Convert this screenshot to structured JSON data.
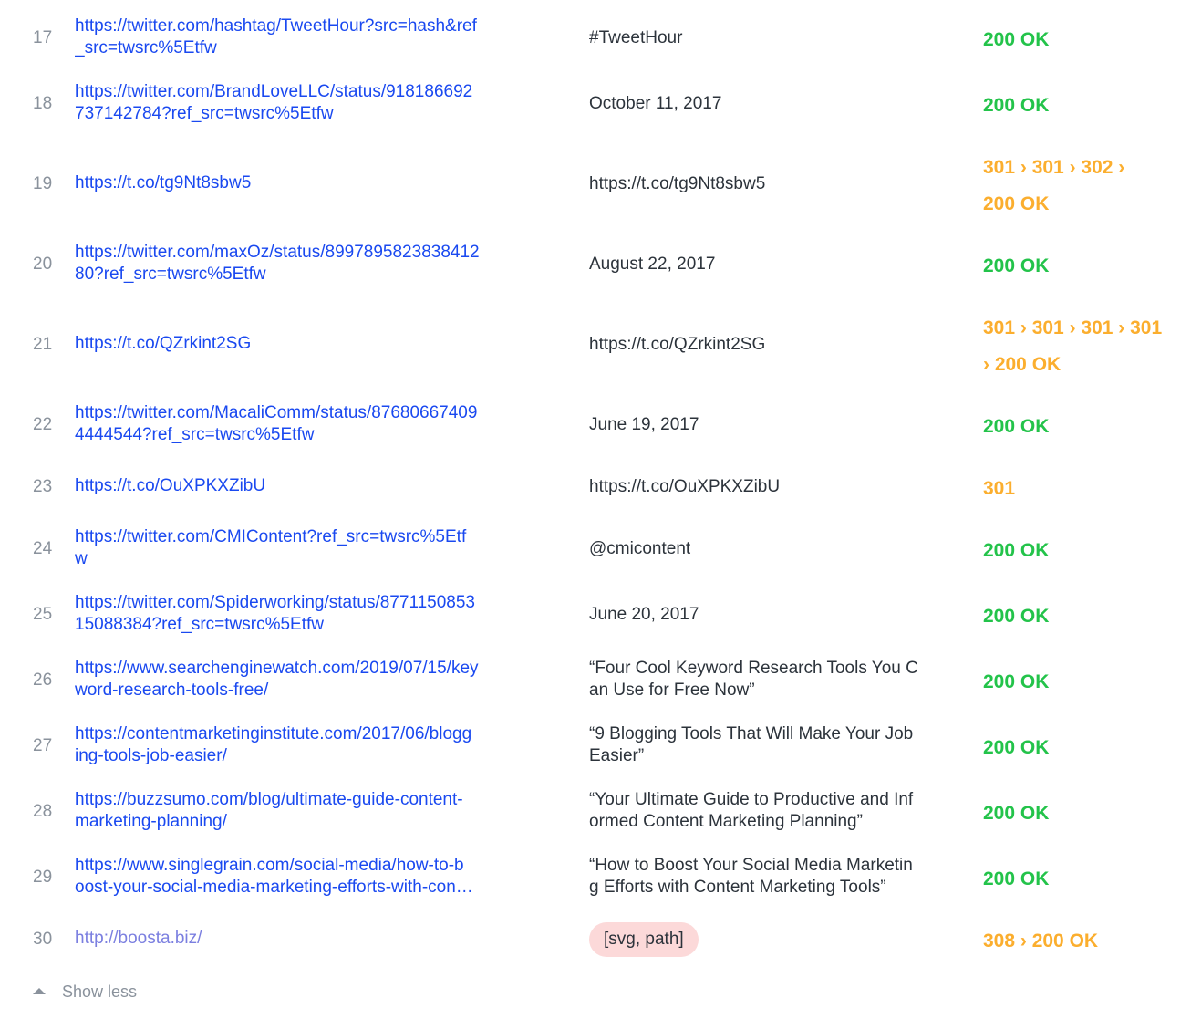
{
  "rows": [
    {
      "num": "17",
      "url_lines": [
        "https://twitter.com/hashtag/TweetHour?src=hash&ref",
        "_src=twsrc%5Etfw"
      ],
      "anchor_lines": [
        "#TweetHour"
      ],
      "status_lines": [
        "200 OK"
      ],
      "status_type": "ok"
    },
    {
      "num": "18",
      "url_lines": [
        "https://twitter.com/BrandLoveLLC/status/918186692",
        "737142784?ref_src=twsrc%5Etfw"
      ],
      "anchor_lines": [
        "October 11, 2017"
      ],
      "status_lines": [
        "200 OK"
      ],
      "status_type": "ok"
    },
    {
      "num": "19",
      "url_lines": [
        "https://t.co/tg9Nt8sbw5"
      ],
      "anchor_lines": [
        "https://t.co/tg9Nt8sbw5"
      ],
      "status_lines": [
        "301 › 301 › 302 ›",
        "200 OK"
      ],
      "status_type": "redir"
    },
    {
      "num": "20",
      "url_lines": [
        "https://twitter.com/maxOz/status/8997895823838412",
        "80?ref_src=twsrc%5Etfw"
      ],
      "anchor_lines": [
        "August 22, 2017"
      ],
      "status_lines": [
        "200 OK"
      ],
      "status_type": "ok"
    },
    {
      "num": "21",
      "url_lines": [
        "https://t.co/QZrkint2SG"
      ],
      "anchor_lines": [
        "https://t.co/QZrkint2SG"
      ],
      "status_lines": [
        "301 › 301 › 301 › 301",
        "› 200 OK"
      ],
      "status_type": "redir"
    },
    {
      "num": "22",
      "url_lines": [
        "https://twitter.com/MacaliComm/status/87680667409",
        "4444544?ref_src=twsrc%5Etfw"
      ],
      "anchor_lines": [
        "June 19, 2017"
      ],
      "status_lines": [
        "200 OK"
      ],
      "status_type": "ok"
    },
    {
      "num": "23",
      "url_lines": [
        "https://t.co/OuXPKXZibU"
      ],
      "anchor_lines": [
        "https://t.co/OuXPKXZibU"
      ],
      "status_lines": [
        "301"
      ],
      "status_type": "redir"
    },
    {
      "num": "24",
      "url_lines": [
        "https://twitter.com/CMIContent?ref_src=twsrc%5Etf",
        "w"
      ],
      "anchor_lines": [
        "@cmicontent"
      ],
      "status_lines": [
        "200 OK"
      ],
      "status_type": "ok"
    },
    {
      "num": "25",
      "url_lines": [
        "https://twitter.com/Spiderworking/status/8771150853",
        "15088384?ref_src=twsrc%5Etfw"
      ],
      "anchor_lines": [
        "June 20, 2017"
      ],
      "status_lines": [
        "200 OK"
      ],
      "status_type": "ok"
    },
    {
      "num": "26",
      "url_lines": [
        "https://www.searchenginewatch.com/2019/07/15/key",
        "word-research-tools-free/"
      ],
      "anchor_lines": [
        "“Four Cool Keyword Research Tools You C",
        "an Use for Free Now”"
      ],
      "status_lines": [
        "200 OK"
      ],
      "status_type": "ok"
    },
    {
      "num": "27",
      "url_lines": [
        "https://contentmarketinginstitute.com/2017/06/blogg",
        "ing-tools-job-easier/"
      ],
      "anchor_lines": [
        "“9 Blogging Tools That Will Make Your Job",
        "Easier”"
      ],
      "status_lines": [
        "200 OK"
      ],
      "status_type": "ok"
    },
    {
      "num": "28",
      "url_lines": [
        "https://buzzsumo.com/blog/ultimate-guide-content-",
        "marketing-planning/"
      ],
      "anchor_lines": [
        "“Your Ultimate Guide to Productive and Inf",
        "ormed Content Marketing Planning”"
      ],
      "status_lines": [
        "200 OK"
      ],
      "status_type": "ok"
    },
    {
      "num": "29",
      "url_lines": [
        "https://www.singlegrain.com/social-media/how-to-b",
        "oost-your-social-media-marketing-efforts-with-con…"
      ],
      "anchor_lines": [
        "“How to Boost Your Social Media Marketin",
        "g Efforts with Content Marketing Tools”"
      ],
      "status_lines": [
        "200 OK"
      ],
      "status_type": "ok"
    },
    {
      "num": "30",
      "url_lines": [
        "http://boosta.biz/"
      ],
      "anchor_lines": [
        "[svg, path]"
      ],
      "anchor_badge": true,
      "url_visited": true,
      "status_lines": [
        "308 › 200 OK"
      ],
      "status_type": "redir"
    }
  ],
  "footer": {
    "show_less_label": "Show less"
  },
  "colors": {
    "link": "#1a49f0",
    "link_visited": "#7b7fe0",
    "ok": "#23c34a",
    "redirect": "#fbae2e",
    "muted": "#8a929c",
    "badge_bg": "#fcd9d9"
  }
}
